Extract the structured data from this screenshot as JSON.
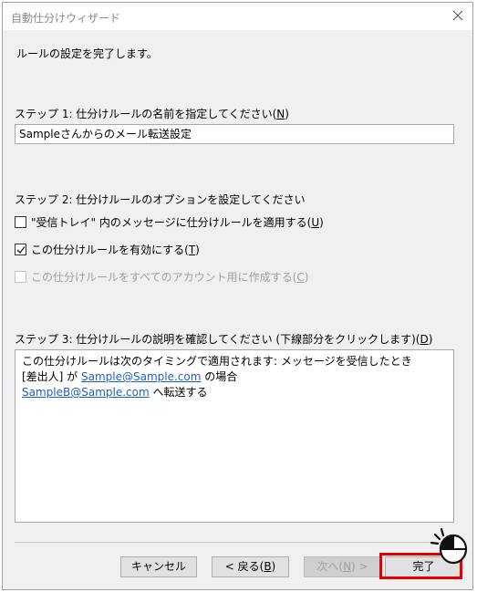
{
  "window": {
    "title": "自動仕分けウィザード"
  },
  "intro": "ルールの設定を完了します。",
  "step1": {
    "label": "ステップ 1: 仕分けルールの名前を指定してください(",
    "key": "N",
    "suffix": ")",
    "value": "Sampleさんからのメール転送設定"
  },
  "step2": {
    "label": "ステップ 2: 仕分けルールのオプションを設定してください",
    "options": [
      {
        "text": "\"受信トレイ\" 内のメッセージに仕分けルールを適用する(",
        "key": "U",
        "suffix": ")",
        "checked": false,
        "enabled": true
      },
      {
        "text": "この仕分けルールを有効にする(",
        "key": "T",
        "suffix": ")",
        "checked": true,
        "enabled": true
      },
      {
        "text": "この仕分けルールをすべてのアカウント用に作成する(",
        "key": "C",
        "suffix": ")",
        "checked": false,
        "enabled": false
      }
    ]
  },
  "step3": {
    "label": "ステップ 3: 仕分けルールの説明を確認してください (下線部分をクリックします)(",
    "key": "D",
    "suffix": ")",
    "line1": "この仕分けルールは次のタイミングで適用されます: メッセージを受信したとき",
    "line2_prefix": "[差出人] が ",
    "line2_link": "Sample@Sample.com",
    "line2_suffix": " の場合",
    "line3_link": "SampleB@Sample.com",
    "line3_suffix": " へ転送する"
  },
  "buttons": {
    "cancel": "キャンセル",
    "back": "< 戻る(",
    "back_key": "B",
    "back_suffix": ")",
    "next": "次へ(",
    "next_key": "N",
    "next_suffix": ") >",
    "finish": "完了"
  },
  "colors": {
    "highlight": "#e60000",
    "link": "#1f5fbf"
  }
}
